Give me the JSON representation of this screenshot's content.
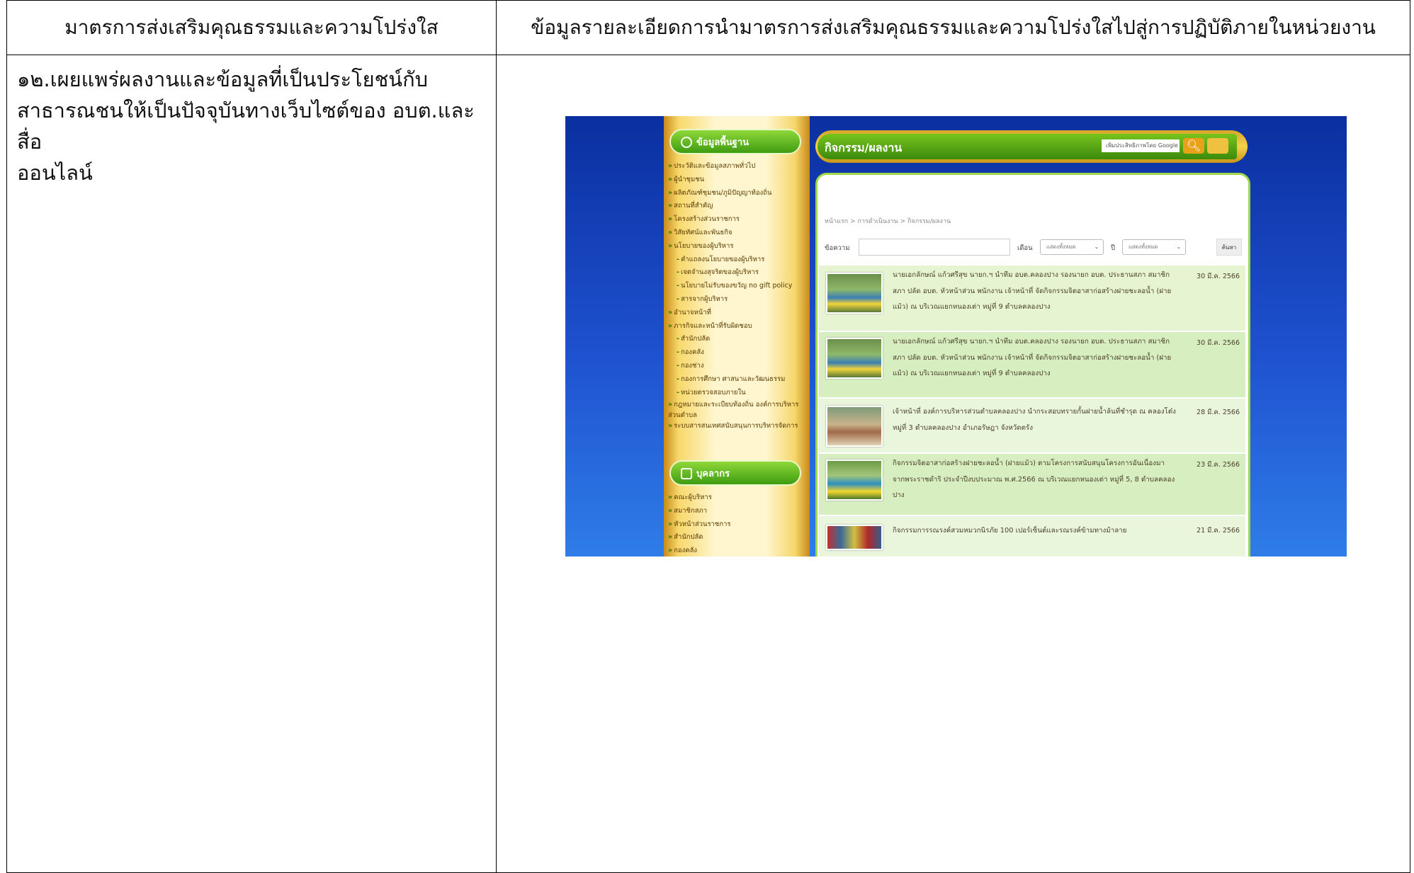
{
  "table": {
    "header_left": "มาตรการส่งเสริมคุณธรรมและความโปร่งใส",
    "header_right": "ข้อมูลรายละเอียดการนำมาตรการส่งเสริมคุณธรรมและความโปร่งใสไปสู่การปฏิบัติภายในหน่วยงาน",
    "measure_lines": [
      "๑๒.เผยแพร่ผลงานและข้อมูลที่เป็นประโยชน์กับ",
      "สาธารณชนให้เป็นปัจจุบันทางเว็บไซต์ของ อบต.และสื่อ",
      "ออนไลน์"
    ]
  },
  "website": {
    "sidebar": {
      "section1_title": "ข้อมูลพื้นฐาน",
      "section1_items": [
        "ประวัติและข้อมูลสภาพทั่วไป",
        "ผู้นำชุมชน",
        "ผลิตภัณฑ์ชุมชน/ภูมิปัญญาท้องถิ่น",
        "สถานที่สำคัญ",
        "โครงสร้างส่วนราชการ",
        "วิสัยทัศน์และพันธกิจ",
        "นโยบายของผู้บริหาร",
        "คำแถลงนโยบายของผู้บริหาร",
        "เจตจำนงสุจริตของผู้บริหาร",
        "นโยบายไม่รับของขวัญ no gift policy",
        "สารจากผู้บริหาร",
        "อำนาจหน้าที่",
        "ภารกิจและหน้าที่รับผิดชอบ",
        "สำนักปลัด",
        "กองคลัง",
        "กองช่าง",
        "กองการศึกษา ศาสนาและวัฒนธรรม",
        "หน่วยตรวจสอบภายใน",
        "กฎหมายและระเบียบท้องถิ่น องค์การบริหารส่วนตำบล",
        "ระบบสารสนเทศสนับสนุนการบริหารจัดการ"
      ],
      "section2_title": "บุคลากร",
      "section2_items": [
        "คณะผู้บริหาร",
        "สมาชิกสภา",
        "หัวหน้าส่วนราชการ",
        "สำนักปลัด",
        "กองคลัง"
      ]
    },
    "main": {
      "title": "กิจกรรม/ผลงาน",
      "search_placeholder": "เพิ่มประสิทธิภาพโดย Google",
      "breadcrumb": "หน้าแรก > การดำเนินงาน > กิจกรรม/ผลงาน",
      "filter": {
        "keyword_label": "ข้อความ",
        "month_label": "เดือน",
        "month_value": "แสดงทั้งหมด",
        "year_label": "ปี",
        "year_value": "แสดงทั้งหมด",
        "search_button": "ค้นหา"
      },
      "news": [
        {
          "text": "นายเอกลักษณ์ แก้วศรีสุข นายก.ฯ นำทีม อบต.คลองปาง รองนายก อบต. ประธานสภา สมาชิกสภา ปลัด อบต. หัวหน้าส่วน พนักงาน เจ้าหน้าที่ จัดกิจกรรมจิตอาสาก่อสร้างฝายชะลอน้ำ (ฝายแม้ว) ณ บริเวณแยกหนองเต่า หมู่ที่ 9 ตำบลคลองปาง",
          "date": "30 มี.ค. 2566"
        },
        {
          "text": "นายเอกลักษณ์ แก้วศรีสุข นายก.ฯ นำทีม อบต.คลองปาง รองนายก อบต. ประธานสภา สมาชิกสภา ปลัด อบต. หัวหน้าส่วน พนักงาน เจ้าหน้าที่ จัดกิจกรรมจิตอาสาก่อสร้างฝายชะลอน้ำ (ฝายแม้ว) ณ บริเวณแยกหนองเต่า หมู่ที่ 9 ตำบลคลองปาง",
          "date": "30 มี.ค. 2566"
        },
        {
          "text": "เจ้าหน้าที่ องค์การบริหารส่วนตำบลคลองปาง นำกระสอบทรายกั้นฝายน้ำล้นที่ชำรุด ณ คลองโต๋ง หมู่ที่ 3 ตำบลคลองปาง อำเภอรัษฎา จังหวัดตรัง",
          "date": "28 มี.ค. 2566"
        },
        {
          "text": "กิจกรรมจิตอาสาก่อสร้างฝายชะลอน้ำ (ฝายแม้ว) ตามโครงการสนับสนุนโครงการอันเนื่องมาจากพระราชดำริ ประจำปีงบประมาณ พ.ศ.2566 ณ บริเวณแยกหนองเต่า หมู่ที่ 5, 8 ตำบลคลองปาง",
          "date": "23 มี.ค. 2566"
        },
        {
          "text": "กิจกรรมการรณรงค์สวมหมวกนิรภัย 100 เปอร์เซ็นต์และรณรงค์ข้ามทางม้าลาย",
          "date": "21 มี.ค. 2566"
        }
      ]
    }
  }
}
